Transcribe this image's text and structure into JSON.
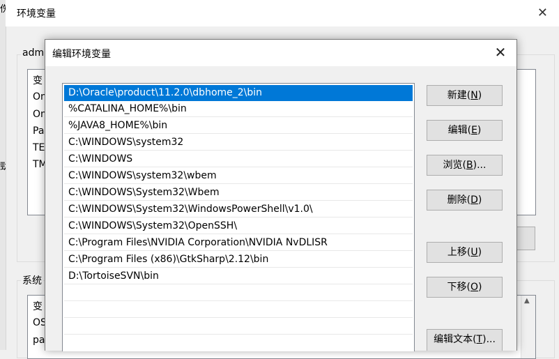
{
  "background_window": {
    "title": "环境变量",
    "user_group_label": "adm",
    "user_vars": [
      "变",
      "On",
      "On",
      "Pa",
      "TE",
      "TM"
    ],
    "system_group_label": "系统",
    "system_vars": [
      "变",
      "OS",
      "pa"
    ]
  },
  "dialog": {
    "title": "编辑环境变量",
    "paths": [
      "D:\\Oracle\\product\\11.2.0\\dbhome_2\\bin",
      "%CATALINA_HOME%\\bin",
      "%JAVA8_HOME%\\bin",
      "C:\\WINDOWS\\system32",
      "C:\\WINDOWS",
      "C:\\WINDOWS\\system32\\wbem",
      "C:\\WINDOWS\\System32\\Wbem",
      "C:\\WINDOWS\\System32\\WindowsPowerShell\\v1.0\\",
      "C:\\WINDOWS\\System32\\OpenSSH\\",
      "C:\\Program Files\\NVIDIA Corporation\\NVIDIA NvDLISR",
      "C:\\Program Files (x86)\\GtkSharp\\2.12\\bin",
      "D:\\TortoiseSVN\\bin",
      "",
      "",
      ""
    ],
    "selected_index": 0,
    "buttons": {
      "new": {
        "label": "新建(",
        "key": "N",
        "end": ")"
      },
      "edit": {
        "label": "编辑(",
        "key": "E",
        "end": ")"
      },
      "browse": {
        "label": "浏览(",
        "key": "B",
        "end": ")..."
      },
      "delete": {
        "label": "删除(",
        "key": "D",
        "end": ")"
      },
      "move_up": {
        "label": "上移(",
        "key": "U",
        "end": ")"
      },
      "move_down": {
        "label": "下移(",
        "key": "O",
        "end": ")"
      },
      "edit_text": {
        "label": "编辑文本(",
        "key": "T",
        "end": ")..."
      }
    }
  },
  "colors": {
    "selection": "#0078d7"
  }
}
